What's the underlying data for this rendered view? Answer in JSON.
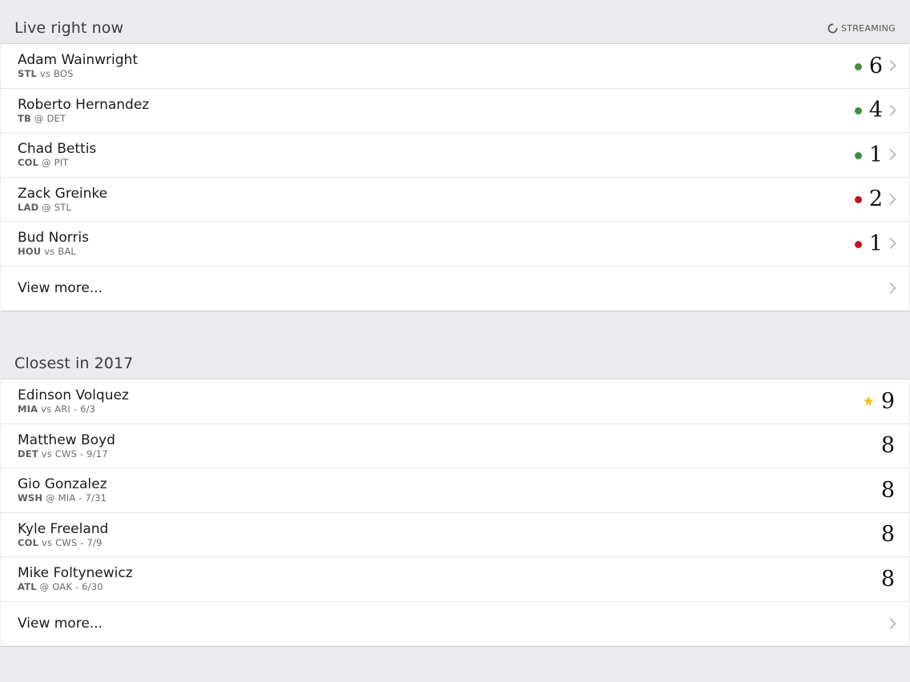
{
  "colors": {
    "live_green": "#3f8f3f",
    "live_red": "#c4141e",
    "star": "#f2c11a",
    "background": "#ebebee"
  },
  "live": {
    "title": "Live right now",
    "streaming_label": "STREAMING",
    "items": [
      {
        "name": "Adam Wainwright",
        "team": "STL",
        "sep": "vs",
        "opp": "BOS",
        "score": "6",
        "status": "green"
      },
      {
        "name": "Roberto Hernandez",
        "team": "TB",
        "sep": "@",
        "opp": "DET",
        "score": "4",
        "status": "green"
      },
      {
        "name": "Chad Bettis",
        "team": "COL",
        "sep": "@",
        "opp": "PIT",
        "score": "1",
        "status": "green"
      },
      {
        "name": "Zack Greinke",
        "team": "LAD",
        "sep": "@",
        "opp": "STL",
        "score": "2",
        "status": "red"
      },
      {
        "name": "Bud Norris",
        "team": "HOU",
        "sep": "vs",
        "opp": "BAL",
        "score": "1",
        "status": "red"
      }
    ],
    "view_more": "View more..."
  },
  "closest": {
    "title": "Closest in 2017",
    "items": [
      {
        "name": "Edinson Volquez",
        "team": "MIA",
        "sep": "vs",
        "opp": "ARI - 6/3",
        "score": "9",
        "star": true
      },
      {
        "name": "Matthew Boyd",
        "team": "DET",
        "sep": "vs",
        "opp": "CWS - 9/17",
        "score": "8"
      },
      {
        "name": "Gio Gonzalez",
        "team": "WSH",
        "sep": "@",
        "opp": "MIA - 7/31",
        "score": "8"
      },
      {
        "name": "Kyle Freeland",
        "team": "COL",
        "sep": "vs",
        "opp": "CWS - 7/9",
        "score": "8"
      },
      {
        "name": "Mike Foltynewicz",
        "team": "ATL",
        "sep": "@",
        "opp": "OAK - 6/30",
        "score": "8"
      }
    ],
    "view_more": "View more..."
  }
}
